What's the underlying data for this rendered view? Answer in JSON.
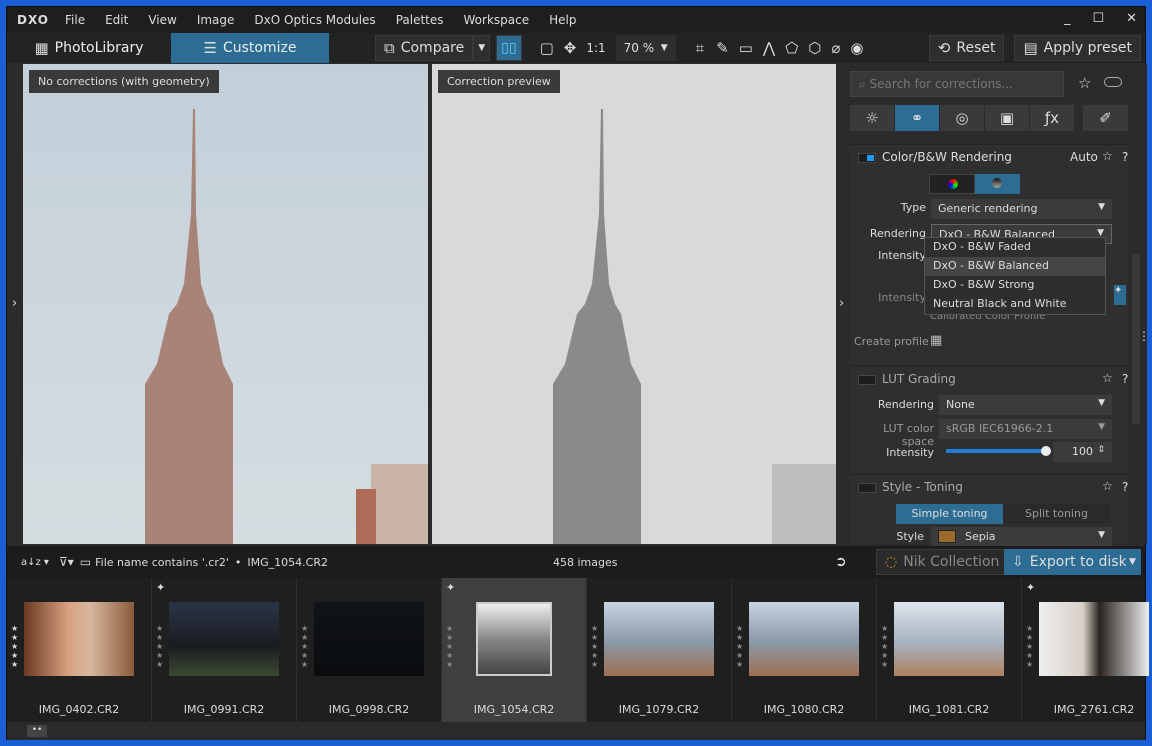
{
  "menubar": {
    "logo": "DXO",
    "items": [
      "File",
      "Edit",
      "View",
      "Image",
      "DxO Optics Modules",
      "Palettes",
      "Workspace",
      "Help"
    ]
  },
  "window_controls": {
    "minimize": "_",
    "maximize": "☐",
    "close": "✕"
  },
  "toolbar": {
    "tab_photolibrary": "PhotoLibrary",
    "tab_customize": "Customize",
    "compare": "Compare",
    "one_to_one": "1:1",
    "zoom": "70 %",
    "reset": "Reset",
    "apply_preset": "Apply preset"
  },
  "viewer": {
    "left_label": "No corrections (with geometry)",
    "right_label": "Correction preview"
  },
  "panel": {
    "search_placeholder": "Search for corrections...",
    "color_bw": {
      "title": "Color/B&W Rendering",
      "auto": "Auto",
      "help": "?",
      "type_label": "Type",
      "type_value": "Generic rendering",
      "rendering_label": "Rendering",
      "rendering_value": "DxO - B&W Balanced",
      "intensity_label": "Intensity",
      "intensity2_label": "Intensity",
      "create_profile": "Create profile",
      "partial_text": "Calibrated Color Profile",
      "options": [
        "DxO - B&W Faded",
        "DxO - B&W Balanced",
        "DxO - B&W Strong",
        "Neutral Black and White"
      ],
      "highlighted": "DxO - B&W Balanced"
    },
    "lut": {
      "title": "LUT Grading",
      "help": "?",
      "rendering_label": "Rendering",
      "rendering_value": "None",
      "space_label": "LUT color space",
      "space_value": "sRGB IEC61966-2.1",
      "intensity_label": "Intensity",
      "intensity_value": "100",
      "intensity_fraction": 1.0
    },
    "toning": {
      "title": "Style - Toning",
      "help": "?",
      "simple": "Simple toning",
      "split": "Split toning",
      "style_label": "Style",
      "style_value": "Sepia",
      "style_color": "#9a6a2c"
    }
  },
  "filmstrip": {
    "filter": "File name contains '.cr2'",
    "separator": "•",
    "current": "IMG_1054.CR2",
    "count": "458 images",
    "nik": "Nik Collection",
    "export": "Export to disk",
    "items": [
      {
        "name": "IMG_0402.CR2"
      },
      {
        "name": "IMG_0991.CR2"
      },
      {
        "name": "IMG_0998.CR2"
      },
      {
        "name": "IMG_1054.CR2"
      },
      {
        "name": "IMG_1079.CR2"
      },
      {
        "name": "IMG_1080.CR2"
      },
      {
        "name": "IMG_1081.CR2"
      },
      {
        "name": "IMG_2761.CR2"
      }
    ]
  },
  "colors": {
    "accent": "#2d6d93",
    "desktop": "#1b5fd6",
    "slider": "#1e7fd8"
  }
}
